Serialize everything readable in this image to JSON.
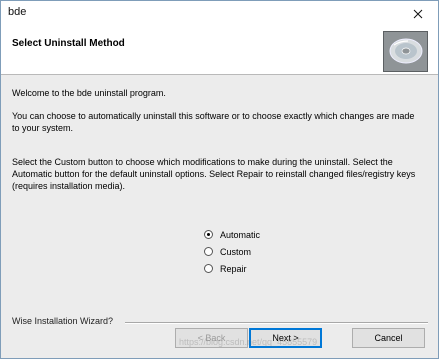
{
  "window": {
    "title": "bde"
  },
  "header": {
    "title": "Select Uninstall Method"
  },
  "body": {
    "welcome": "Welcome to the bde uninstall program.",
    "choice": "You can choose to automatically uninstall this software or to choose exactly which changes are made to your system.",
    "instructions": "Select the Custom button to choose which modifications to make during the uninstall. Select the Automatic button for the default uninstall options. Select Repair to reinstall changed files/registry keys (requires installation media)."
  },
  "options": [
    {
      "label": "Automatic",
      "checked": true
    },
    {
      "label": "Custom",
      "checked": false
    },
    {
      "label": "Repair",
      "checked": false
    }
  ],
  "footer": {
    "wizard_label": "Wise Installation Wizard?"
  },
  "buttons": {
    "back": "< Back",
    "next": "Next >",
    "cancel": "Cancel"
  },
  "watermark": "https://blog.csdn.net/qq_45855579"
}
